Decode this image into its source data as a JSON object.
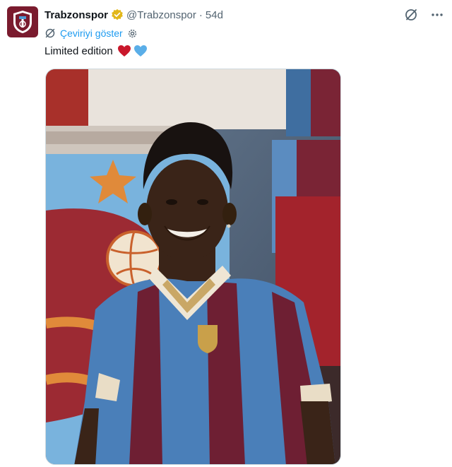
{
  "account": {
    "name": "Trabzonspor",
    "handle": "@Trabzonspor",
    "separator": "·",
    "time": "54d"
  },
  "translate": {
    "label": "Çeviriyi göster"
  },
  "tweet": {
    "text": "Limited edition"
  },
  "icons": {
    "verified": "verified-badge-icon",
    "grok": "grok-icon",
    "more": "more-icon",
    "translate": "translate-icon",
    "settings": "gear-icon",
    "emoji_1": "red-heart-emoji",
    "emoji_2": "blue-heart-emoji"
  },
  "colors": {
    "link": "#1d9bf0",
    "muted": "#536471",
    "verified_gold": "#e2b719",
    "brand_maroon": "#7a1b2e",
    "brand_blue": "#4f9ad3"
  },
  "menu": {
    "more_label": "···"
  }
}
